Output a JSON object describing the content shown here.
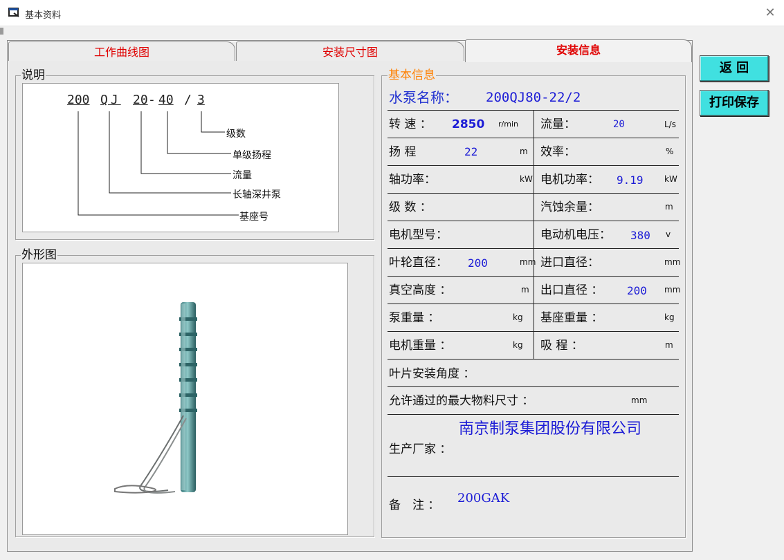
{
  "window": {
    "title": "基本资料",
    "close_glyph": "✕"
  },
  "tabs": {
    "work_curve": "工作曲线图",
    "install_dim": "安装尺寸图",
    "install_info": "安装信息"
  },
  "buttons": {
    "back": "返 回",
    "print_save": "打印保存"
  },
  "explain": {
    "group_label": "说明",
    "code": {
      "base": "200",
      "type": "QJ",
      "flow": "20",
      "dash": "-",
      "head": "40",
      "slash": "/",
      "stages": "3"
    },
    "labels": {
      "stages": "级数",
      "single_head": "单级扬程",
      "flow": "流量",
      "type": "长轴深井泵",
      "base": "基座号"
    }
  },
  "shape": {
    "group_label": "外形图"
  },
  "info": {
    "group_label": "基本信息",
    "pump_name_label": "水泵名称：",
    "pump_name": "200QJ80-22/2",
    "rows": {
      "speed_label": "转 速 ：",
      "speed_value": "2850",
      "speed_unit": "r/min",
      "flow_label": "流量：",
      "flow_value": "20",
      "flow_unit": "L/s",
      "head_label": "扬 程",
      "head_value": "22",
      "head_unit": "m",
      "eff_label": "效率：",
      "eff_value": "",
      "eff_unit": "%",
      "shaft_power_label": "轴功率：",
      "shaft_power_value": "",
      "shaft_power_unit": "kW",
      "motor_power_label": "电机功率：",
      "motor_power_value": "9.19",
      "motor_power_unit": "kW",
      "stages_label": "级 数 ：",
      "stages_value": "",
      "npsh_label": "汽蚀余量：",
      "npsh_value": "",
      "npsh_unit": "m",
      "motor_model_label": "电机型号：",
      "motor_model_value": "",
      "motor_voltage_label": "电动机电压：",
      "motor_voltage_value": "380",
      "motor_voltage_unit": "v",
      "impeller_label": "叶轮直径：",
      "impeller_value": "200",
      "impeller_unit": "mm",
      "inlet_label": "进口直径：",
      "inlet_value": "",
      "inlet_unit": "mm",
      "vacuum_label": "真空高度 ：",
      "vacuum_value": "",
      "vacuum_unit": "m",
      "outlet_label": "出口直径 ：",
      "outlet_value": "200",
      "outlet_unit": "mm",
      "pump_weight_label": "泵重量 ：",
      "pump_weight_value": "",
      "pump_weight_unit": "kg",
      "base_weight_label": "基座重量 ：",
      "base_weight_value": "",
      "base_weight_unit": "kg",
      "motor_weight_label": "电机重量 ：",
      "motor_weight_value": "",
      "motor_weight_unit": "kg",
      "suction_label": "吸 程 ：",
      "suction_value": "",
      "suction_unit": "m"
    },
    "blade_angle_label": "叶片安装角度 ：",
    "max_size_label": "允许通过的最大物料尺寸 ：",
    "max_size_unit": "mm",
    "maker_value": "南京制泵集团股份有限公司",
    "maker_label": "生产厂家 ：",
    "remark_label": "备　注 ：",
    "remark_value": "200GAK"
  },
  "colors": {
    "tab_text": "#e00000",
    "value_text": "#1c1cd6",
    "group_info_label": "#ff8000",
    "button_bg": "#40e0e0"
  }
}
